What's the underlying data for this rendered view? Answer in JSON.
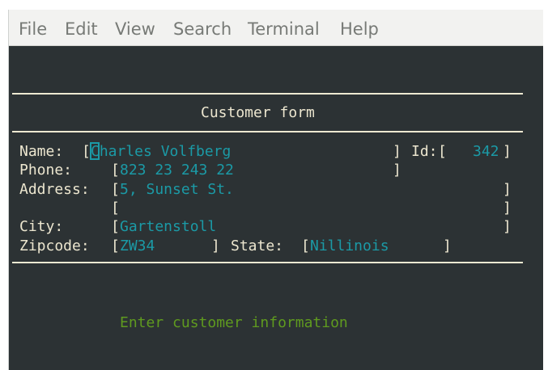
{
  "menubar": {
    "items": [
      "File",
      "Edit",
      "View",
      "Search",
      "Terminal",
      "Help"
    ]
  },
  "form": {
    "title": "Customer form",
    "name_label": "Name:",
    "name_value": "Charles Volfberg",
    "id_label": "Id:",
    "id_value": "342",
    "phone_label": "Phone:",
    "phone_value": "823 23 243 22",
    "address_label": "Address:",
    "address_line1": "5, Sunset St.",
    "address_line2": "",
    "city_label": "City:",
    "city_value": "Gartenstoll",
    "zipcode_label": "Zipcode:",
    "zipcode_value": "ZW34",
    "state_label": "State:",
    "state_value": "Nillinois"
  },
  "status": {
    "message": "Enter customer information"
  },
  "colors": {
    "background": "#2c3234",
    "label": "#ece6cf",
    "field_value": "#1b9aa6",
    "status": "#5f9a1f"
  }
}
